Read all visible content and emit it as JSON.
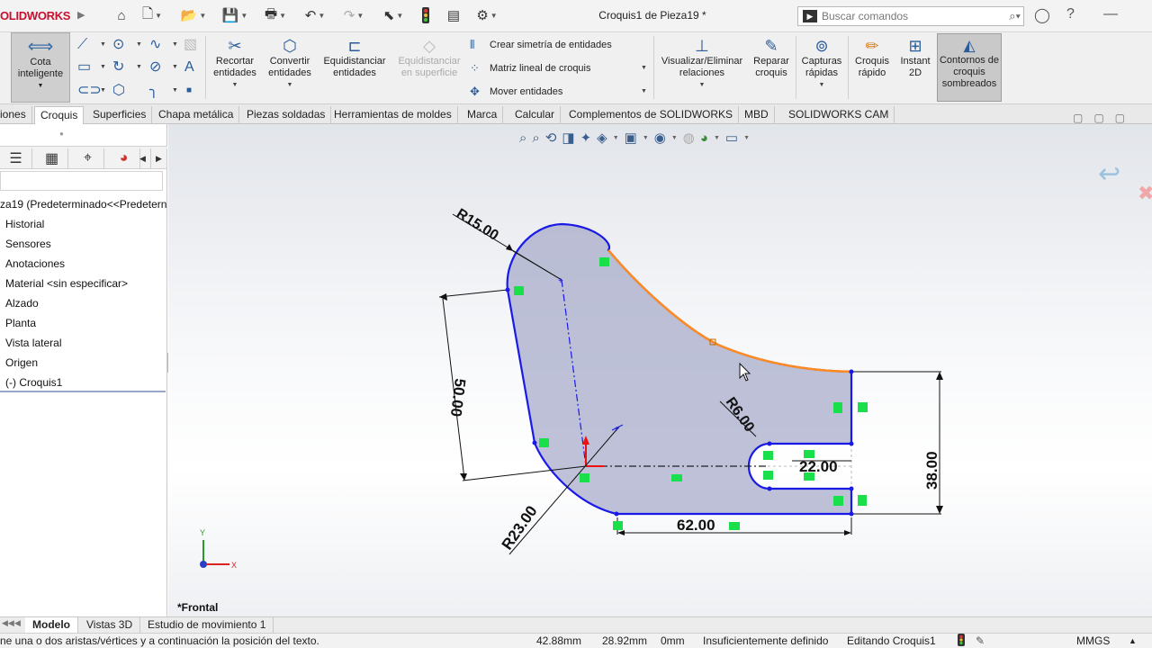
{
  "app": {
    "logo": "OLIDWORKS",
    "document_title": "Croquis1 de Pieza19 *",
    "search_placeholder": "Buscar comandos"
  },
  "ribbon": {
    "smart_dimension": "Cota inteligente",
    "trim": "Recortar entidades",
    "convert": "Convertir entidades",
    "offset": "Equidistanciar entidades",
    "offset_surface": "Equidistanciar en superficie",
    "mirror": "Crear simetría de entidades",
    "linear_pattern": "Matriz lineal de croquis",
    "move": "Mover entidades",
    "relations": "Visualizar/Eliminar relaciones",
    "repair": "Reparar croquis",
    "quick_snaps": "Capturas rápidas",
    "rapid_sketch": "Croquis rápido",
    "instant2d": "Instant 2D",
    "shaded_contours": "Contornos de croquis sombreados"
  },
  "tabs": [
    "iones",
    "Croquis",
    "Superficies",
    "Chapa metálica",
    "Piezas soldadas",
    "Herramientas de moldes",
    "Marca",
    "Calcular",
    "Complementos de SOLIDWORKS",
    "MBD",
    "SOLIDWORKS CAM"
  ],
  "active_tab": "Croquis",
  "tree": {
    "root": "za19  (Predeterminado<<Predetern",
    "items": [
      "Historial",
      "Sensores",
      "Anotaciones",
      "Material <sin especificar>",
      "Alzado",
      "Planta",
      "Vista lateral",
      "Origen",
      "(-) Croquis1"
    ]
  },
  "sketch": {
    "dimensions": [
      "R15.00",
      "50.00",
      "R23.00",
      "R6.00",
      "22.00",
      "38.00",
      "62.00"
    ],
    "axis_x": "X",
    "axis_y": "Y",
    "view_name": "*Frontal"
  },
  "colors": {
    "sketch_line": "#1a1ae6",
    "selected_edge": "#ff8a1f",
    "relation_badge": "#19e04a",
    "fill": "#a8acc9"
  },
  "bottom_tabs": [
    "Modelo",
    "Vistas 3D",
    "Estudio de movimiento 1"
  ],
  "status": {
    "message": "ne una o dos aristas/vértices y a continuación la posición del texto.",
    "x": "42.88mm",
    "y": "28.92mm",
    "z": "0mm",
    "state": "Insuficientemente definido",
    "mode": "Editando Croquis1",
    "units": "MMGS"
  }
}
